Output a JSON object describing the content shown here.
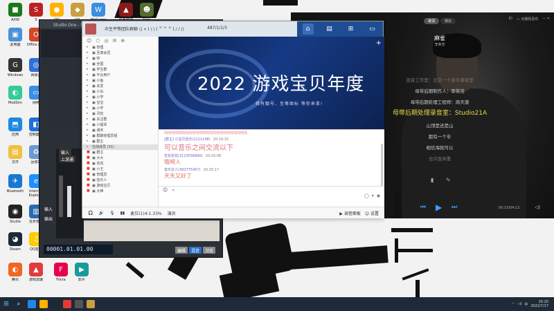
{
  "desktop": {
    "icons": [
      {
        "label": "AXW",
        "color": "#1a7a1a",
        "glyph": "■"
      },
      {
        "label": "S",
        "color": "#b22",
        "glyph": "S"
      },
      {
        "label": "QQ",
        "color": "#ffb300",
        "glyph": "●"
      },
      {
        "label": "LOL",
        "color": "#c8a040",
        "glyph": "◆"
      },
      {
        "label": "WeGame",
        "color": "#3b8fe0",
        "glyph": "W"
      },
      {
        "label": "红色警戒",
        "color": "#8b1a1a",
        "glyph": "▲"
      },
      {
        "label": "Dota",
        "color": "#556b2f",
        "glyph": "☻"
      },
      {
        "label": "此电脑",
        "color": "#4a90d9",
        "glyph": "▣"
      },
      {
        "label": "Office 应用",
        "color": "#d24726",
        "glyph": "O"
      },
      {
        "label": "Windows",
        "color": "#333",
        "glyph": "G"
      },
      {
        "label": "网易云",
        "color": "#2f6fd6",
        "glyph": "◎"
      },
      {
        "label": "ModSim",
        "color": "#3c9",
        "glyph": "◐"
      },
      {
        "label": "网络",
        "color": "#3a8ee6",
        "glyph": "▭"
      },
      {
        "label": "应用",
        "color": "#1e88e5",
        "glyph": "⬒"
      },
      {
        "label": "控制面板",
        "color": "#1e6fd9",
        "glyph": "◧"
      },
      {
        "label": "文件",
        "color": "#f0c040",
        "glyph": "▤"
      },
      {
        "label": "回收站",
        "color": "#6a9ad0",
        "glyph": "♻"
      },
      {
        "label": "Bluetooth",
        "color": "#1976d2",
        "glyph": "✈"
      },
      {
        "label": "Internet Explorer",
        "color": "#1e90ff",
        "glyph": "e"
      },
      {
        "label": "Studio",
        "color": "#222",
        "glyph": "◉"
      },
      {
        "label": "任务管理",
        "color": "#2a6ab0",
        "glyph": "▥"
      },
      {
        "label": "Steam",
        "color": "#1b2838",
        "glyph": "◕"
      },
      {
        "label": "QQ音乐",
        "color": "#ffcc00",
        "glyph": "♫"
      },
      {
        "label": "腾讯",
        "color": "#f26522",
        "glyph": "◐"
      },
      {
        "label": "游戏加速",
        "color": "#e03c3c",
        "glyph": "▲"
      },
      {
        "label": "Forza",
        "color": "#e6004c",
        "glyph": "F"
      },
      {
        "label": "影片",
        "color": "#1a9a9a",
        "glyph": "▶"
      }
    ]
  },
  "daw": {
    "title": "Studio One - 新建歌曲",
    "transport_time": "00001.01.01.00",
    "labels": [
      "输入",
      "上游通",
      "输入",
      "输出"
    ],
    "bottom_tags": [
      "编辑",
      "混音",
      "浏览"
    ]
  },
  "qq": {
    "title": "众生平等团队群聊 ⟨⟨ ⋄ ) \\ \\ ( ꒪ ꒳ ꒪ ) / / ⟩⟩",
    "group_id": "487/1/1/3",
    "tabs": [
      "home",
      "list",
      "game",
      "file"
    ],
    "member_icons": [
      "☺",
      "⬡",
      "◎",
      "✉",
      "⊕"
    ],
    "members": [
      "▣ 管理",
      "▣ 至尊会员",
      "▣ 帅",
      "▣ 全国",
      "▣ 学生群",
      "▣ 平台用户",
      "▣ 小鱼",
      "▣ 关爱",
      "▣ 小白",
      "▣ 小学",
      "▣ 宝宝",
      "▣ 小学",
      "▣ 灵蛇",
      "▣ 关注群",
      "▣ 小提琴",
      "▣ 城市",
      "▣ 群聊管理员组",
      "▣ 群主"
    ],
    "online_header": "在线成员 (31)",
    "online_members": [
      "▣ 群主",
      "▣ 大大",
      "▣ 花花",
      "▣ 小王",
      "▣ 管理员",
      "▣ 音乐人",
      "▣ 游戏宝贝",
      "▣ 大神"
    ],
    "bottom_members_bar": [
      "🎧",
      "🔊",
      "🎙",
      "⇪"
    ],
    "banner": {
      "title": "2022 游戏宝贝年度",
      "subtitle": "稀有靓号、至尊图标 等你来拿!"
    },
    "chat_dots": "呜呜呜呜呜呜呜呜呜呜呜呜呜呜呜呜呜呜呜呜呜呜呜呜",
    "messages": [
      {
        "name": "[群主] 小宝贝音乐(1111108)",
        "time": "20:19:15",
        "text": "可以音乐之间交流以下",
        "size": "big"
      },
      {
        "name": "花花花花(2123556890)",
        "time": "20:20:08",
        "text": "哦啊人",
        "size": "small"
      },
      {
        "name": "音乐达人(392775457)",
        "time": "20:20:17",
        "text": "天天又好了",
        "size": "small"
      }
    ],
    "footer": {
      "items": [
        "🎧",
        "🔊",
        "🎙",
        "▮▮"
      ],
      "left_text": "麦位(1)4:1.33%",
      "mid_text": "演员",
      "right_items": [
        "▶ 调音面板",
        "☺ 设置"
      ]
    }
  },
  "player": {
    "tabs": [
      "歌词",
      "相关"
    ],
    "song_name": "麻雀",
    "artist": "李荣浩",
    "lyrics": [
      {
        "text": "混音工作室：北京一十音乐录音室",
        "style": "dim"
      },
      {
        "text": "母带后期制作人：李荣浩",
        "style": "normal"
      },
      {
        "text": "母带后期处理工程师：周天澈",
        "style": "normal"
      },
      {
        "text": "母带后期处理录音室：Studio21A",
        "style": "cur"
      },
      {
        "text": "山顶是还是山",
        "style": "normal"
      },
      {
        "text": "都有一个辛",
        "style": "normal"
      },
      {
        "text": "相信海就可以",
        "style": "normal"
      },
      {
        "text": "也许放弃重",
        "style": "dim"
      }
    ],
    "top_right": [
      "ID",
      "▭ 点播我喜欢",
      "— ✕"
    ],
    "time": "00:15/04:12"
  },
  "taskbar": {
    "time": "20:20",
    "date": "2022/7/17"
  }
}
